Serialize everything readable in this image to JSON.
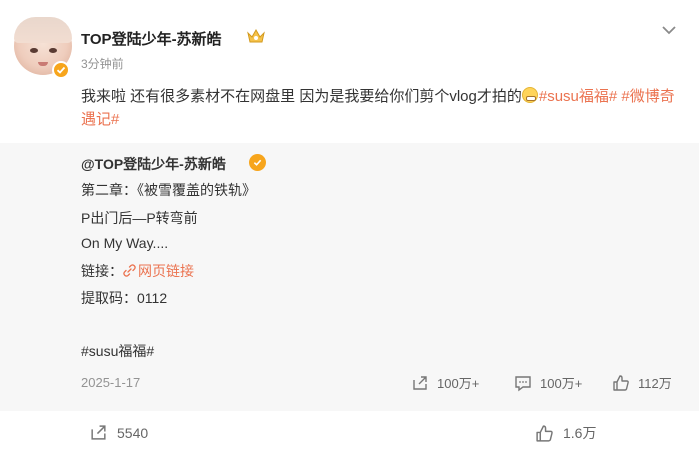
{
  "post": {
    "author": "TOP登陆少年-苏新皓",
    "time": "3分钟前",
    "text_main": "我来啦 还有很多素材不在网盘里 因为是我要给你们剪个vlog才拍的",
    "tag1": "#susu福福#",
    "tag2": "#微博奇遇记#"
  },
  "repost": {
    "author": "@TOP登陆少年-苏新皓",
    "line1": "第二章：《被雪覆盖的铁轨》",
    "line2": "P出门后—P转弯前",
    "line3": "On My Way....",
    "link_label": "链接：",
    "link_text": "网页链接",
    "code": "提取码：0112",
    "tag": "#susu福福#",
    "date": "2025-1-17",
    "share_count": "100万+",
    "comment_count": "100万+",
    "like_count": "112万"
  },
  "footer": {
    "share_count": "5540",
    "like_count": "1.6万"
  }
}
